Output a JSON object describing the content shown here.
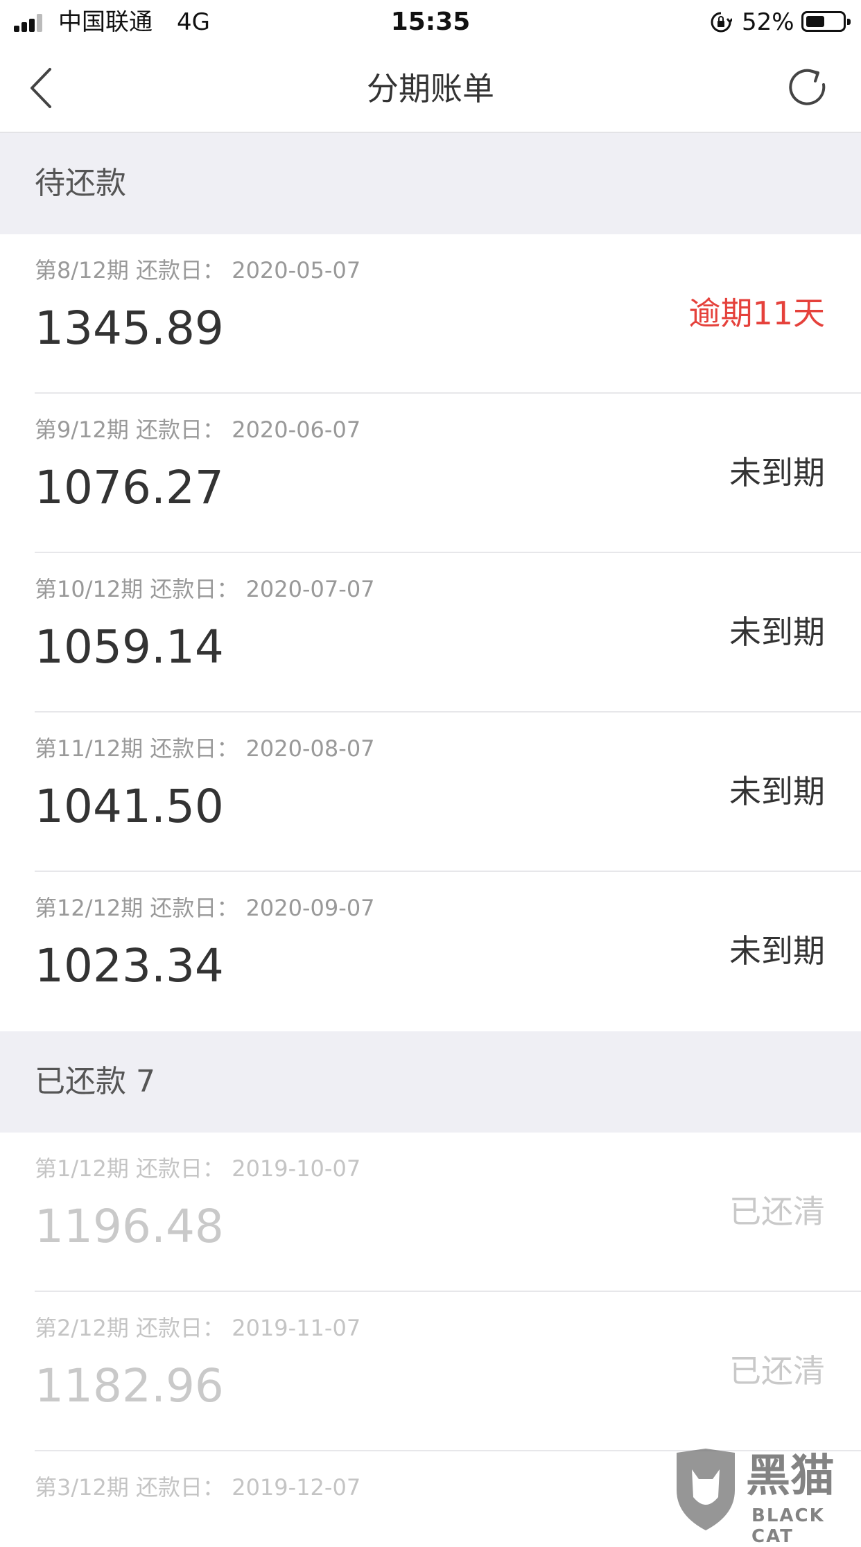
{
  "status_bar": {
    "carrier": "中国联通",
    "network": "4G",
    "time": "15:35",
    "battery_percent": "52%",
    "battery_level": 0.52,
    "icons": [
      "signal-icon",
      "orientation-lock-icon",
      "battery-icon"
    ]
  },
  "nav": {
    "title": "分期账单",
    "back_icon": "chevron-left-icon",
    "refresh_icon": "refresh-icon"
  },
  "pending_section": {
    "title": "待还款",
    "items": [
      {
        "meta": "第8/12期 还款日：  2020-05-07",
        "amount": "1345.89",
        "status": "逾期11天"
      },
      {
        "meta": "第9/12期 还款日：  2020-06-07",
        "amount": "1076.27",
        "status": "未到期"
      },
      {
        "meta": "第10/12期 还款日：  2020-07-07",
        "amount": "1059.14",
        "status": "未到期"
      },
      {
        "meta": "第11/12期 还款日：  2020-08-07",
        "amount": "1041.50",
        "status": "未到期"
      },
      {
        "meta": "第12/12期 还款日：  2020-09-07",
        "amount": "1023.34",
        "status": "未到期"
      }
    ]
  },
  "paid_section": {
    "title": "已还款 7",
    "items": [
      {
        "meta": "第1/12期 还款日：  2019-10-07",
        "amount": "1196.48",
        "status": "已还清"
      },
      {
        "meta": "第2/12期 还款日：  2019-11-07",
        "amount": "1182.96",
        "status": "已还清"
      },
      {
        "meta": "第3/12期 还款日：  2019-12-07",
        "amount": "",
        "status": ""
      }
    ]
  },
  "watermark": {
    "text": "黑猫",
    "sub": "BLACK CAT"
  },
  "colors": {
    "overdue": "#e5413b",
    "section_bg": "#efeff4",
    "text": "#333333",
    "muted": "#999999"
  }
}
